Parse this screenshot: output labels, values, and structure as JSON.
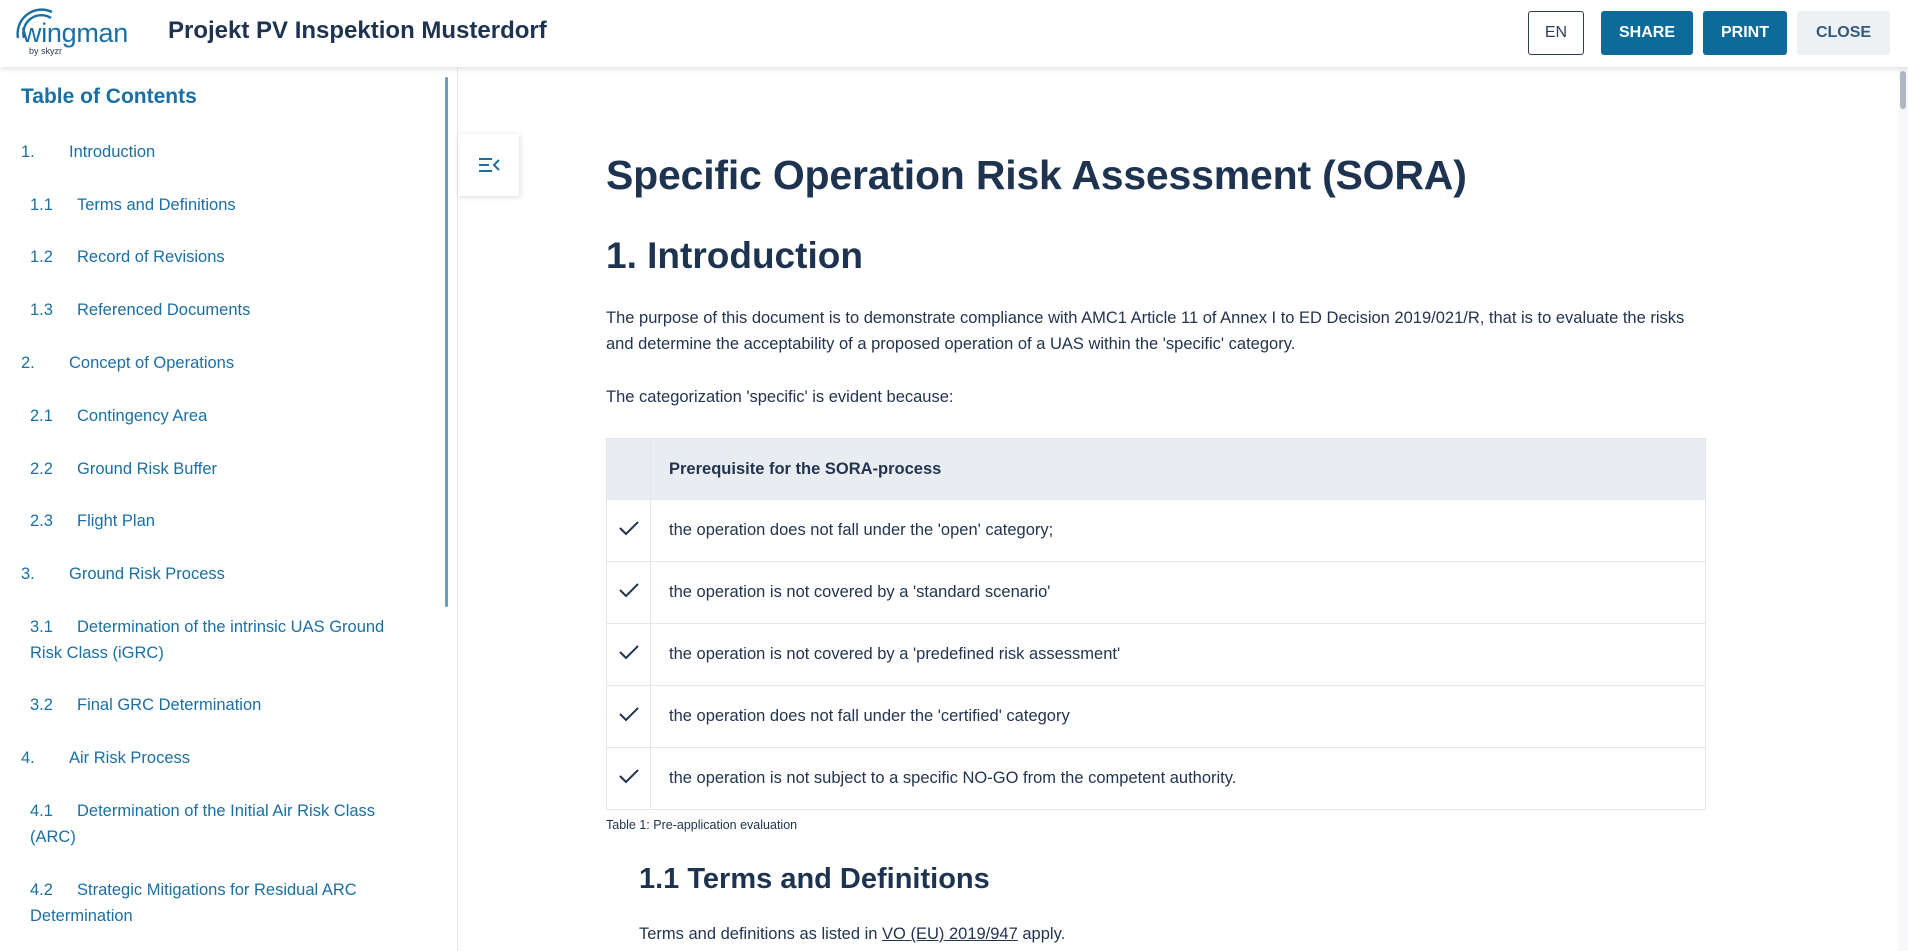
{
  "header": {
    "logo_text": "wingman",
    "logo_sub": "by skyzr",
    "project_title": "Projekt PV Inspektion Musterdorf",
    "lang_label": "EN",
    "share_label": "SHARE",
    "print_label": "PRINT",
    "close_label": "CLOSE"
  },
  "toc": {
    "heading": "Table of Contents",
    "items": [
      {
        "num": "1.",
        "label": "Introduction"
      },
      {
        "num": "1.1",
        "label": "Terms and Definitions"
      },
      {
        "num": "1.2",
        "label": "Record of Revisions"
      },
      {
        "num": "1.3",
        "label": "Referenced Documents"
      },
      {
        "num": "2.",
        "label": "Concept of Operations"
      },
      {
        "num": "2.1",
        "label": "Contingency Area"
      },
      {
        "num": "2.2",
        "label": "Ground Risk Buffer"
      },
      {
        "num": "2.3",
        "label": "Flight Plan"
      },
      {
        "num": "3.",
        "label": "Ground Risk Process"
      },
      {
        "num": "3.1",
        "label": "Determination of the intrinsic UAS Ground Risk Class (iGRC)"
      },
      {
        "num": "3.2",
        "label": "Final GRC Determination"
      },
      {
        "num": "4.",
        "label": "Air Risk Process"
      },
      {
        "num": "4.1",
        "label": "Determination of the Initial Air Risk Class (ARC)"
      },
      {
        "num": "4.2",
        "label": "Strategic Mitigations for Residual ARC Determination"
      }
    ]
  },
  "document": {
    "title": "Specific Operation Risk Assessment (SORA)",
    "section1_heading": "1. Introduction",
    "intro_paragraph": "The purpose of this document is to demonstrate compliance with AMC1 Article 11 of Annex I to ED Decision 2019/021/R, that is to evaluate the risks and determine the acceptability of a proposed operation of a UAS within the 'specific' category.",
    "categorization_text": "The categorization 'specific' is evident because:",
    "table": {
      "header": "Prerequisite for the SORA-process",
      "rows": [
        "the operation does not fall under the 'open' category;",
        "the operation is not covered by a 'standard scenario'",
        "the operation is not covered by a 'predefined risk assessment'",
        "the operation does not fall under the 'certified' category",
        "the operation is not subject to a specific NO-GO from the competent authority."
      ],
      "caption": "Table 1: Pre-application evaluation"
    },
    "section11_heading": "1.1 Terms and Definitions",
    "terms_prefix": "Terms and definitions as listed in ",
    "terms_link": "VO (EU) 2019/947",
    "terms_suffix": " apply."
  },
  "colors": {
    "accent": "#0e6a98",
    "link": "#1a6fa3",
    "heading": "#1e3350",
    "table_header_bg": "#e9edf1"
  }
}
